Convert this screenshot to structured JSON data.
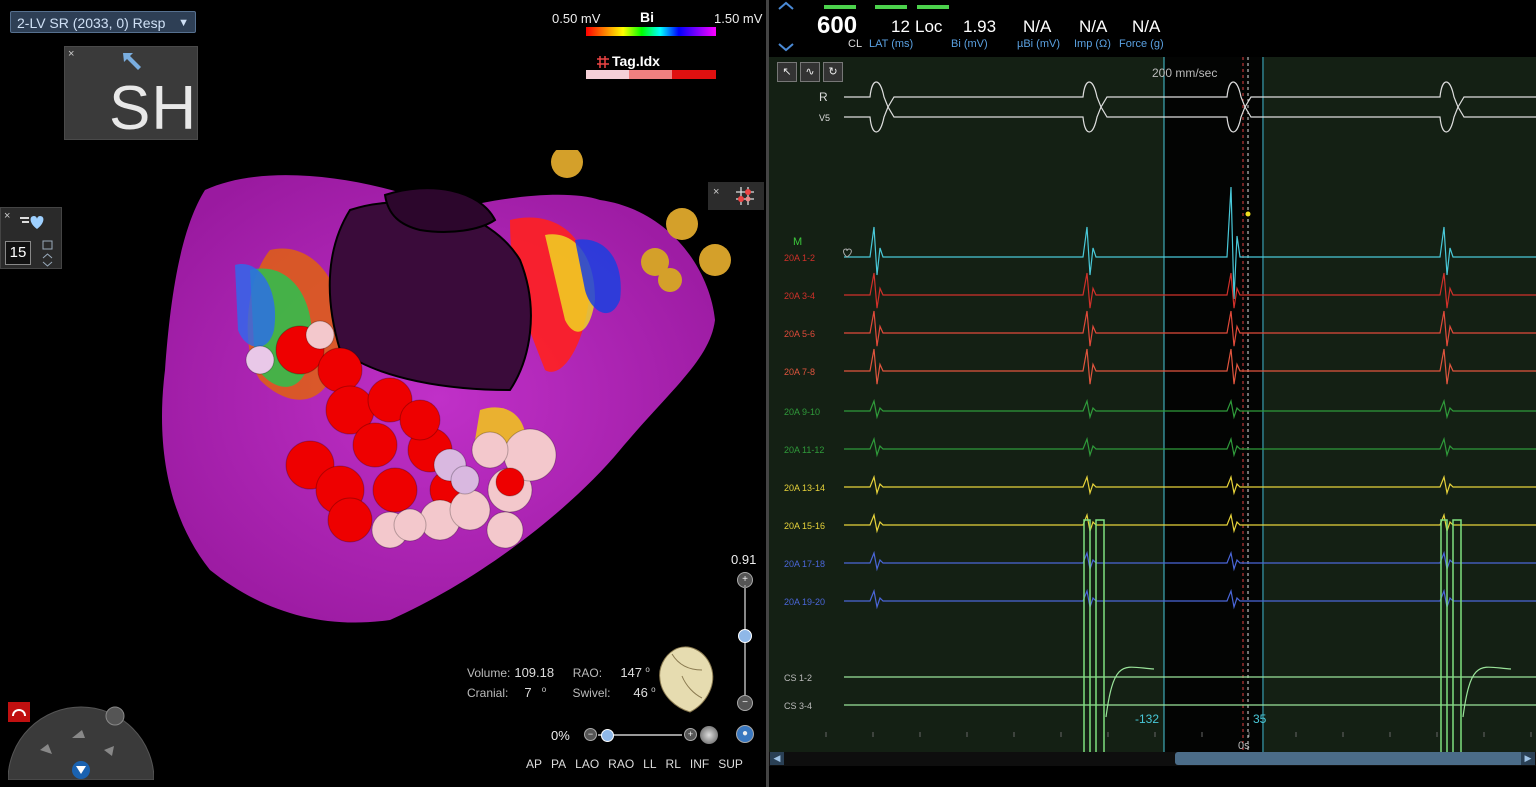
{
  "left_panel": {
    "map_selector": {
      "label": "2-LV SR (2033, 0) Resp"
    },
    "view_label": "SH",
    "cycle_length_value": "15",
    "legend": {
      "min": "0.50 mV",
      "title": "Bi",
      "max": "1.50 mV"
    },
    "tag_index": {
      "label": "Tag.Idx"
    },
    "zoom": {
      "value": "0.91",
      "level_fraction": 0.55
    },
    "stats": {
      "volume_label": "Volume:",
      "volume_value": "109.18",
      "rao_label": "RAO:",
      "rao_value": "147",
      "cranial_label": "Cranial:",
      "cranial_value": "7",
      "swivel_label": "Swivel:",
      "swivel_value": "46",
      "degree": "o"
    },
    "opacity": {
      "value": "0%",
      "level_fraction": 0.1
    },
    "views": [
      "AP",
      "PA",
      "LAO",
      "RAO",
      "LL",
      "RL",
      "INF",
      "SUP"
    ],
    "close_symbol": "×"
  },
  "right_panel": {
    "header": {
      "cl": {
        "value": "600",
        "label": "CL"
      },
      "lat": {
        "value": "12",
        "label": "LAT (ms)"
      },
      "loc": {
        "value": "Loc"
      },
      "bi": {
        "value": "1.93",
        "label": "Bi (mV)"
      },
      "ubi": {
        "value": "N/A",
        "label": "µBi (mV)"
      },
      "imp": {
        "value": "N/A",
        "label": "Imp (Ω)"
      },
      "force": {
        "value": "N/A",
        "label": "Force (g)"
      }
    },
    "speed": "200 mm/sec",
    "map_marker": "M",
    "channels": [
      {
        "label": "R",
        "color": "#dddddd"
      },
      {
        "label": "V5",
        "color": "#dddddd"
      },
      {
        "label": "20A 1-2",
        "color": "#d0302a"
      },
      {
        "label": "20A 3-4",
        "color": "#d0302a"
      },
      {
        "label": "20A 5-6",
        "color": "#e04a3a"
      },
      {
        "label": "20A 7-8",
        "color": "#e0553e"
      },
      {
        "label": "20A 9-10",
        "color": "#2f9a3a"
      },
      {
        "label": "20A 11-12",
        "color": "#2f9a3a"
      },
      {
        "label": "20A 13-14",
        "color": "#e6d23a"
      },
      {
        "label": "20A 15-16",
        "color": "#e6d23a"
      },
      {
        "label": "20A 17-18",
        "color": "#4a66d8"
      },
      {
        "label": "20A 19-20",
        "color": "#4a66d8"
      },
      {
        "label": "CS 1-2",
        "color": "#bbbbbb"
      },
      {
        "label": "CS 3-4",
        "color": "#bbbbbb"
      }
    ],
    "annotations": {
      "left_ms": "-132",
      "right_ms": "35",
      "time_zero": "0s"
    },
    "colors": {
      "trace_bg": "#142014",
      "cyan": "#49c8d8",
      "green_cs": "#7fe07f"
    }
  }
}
